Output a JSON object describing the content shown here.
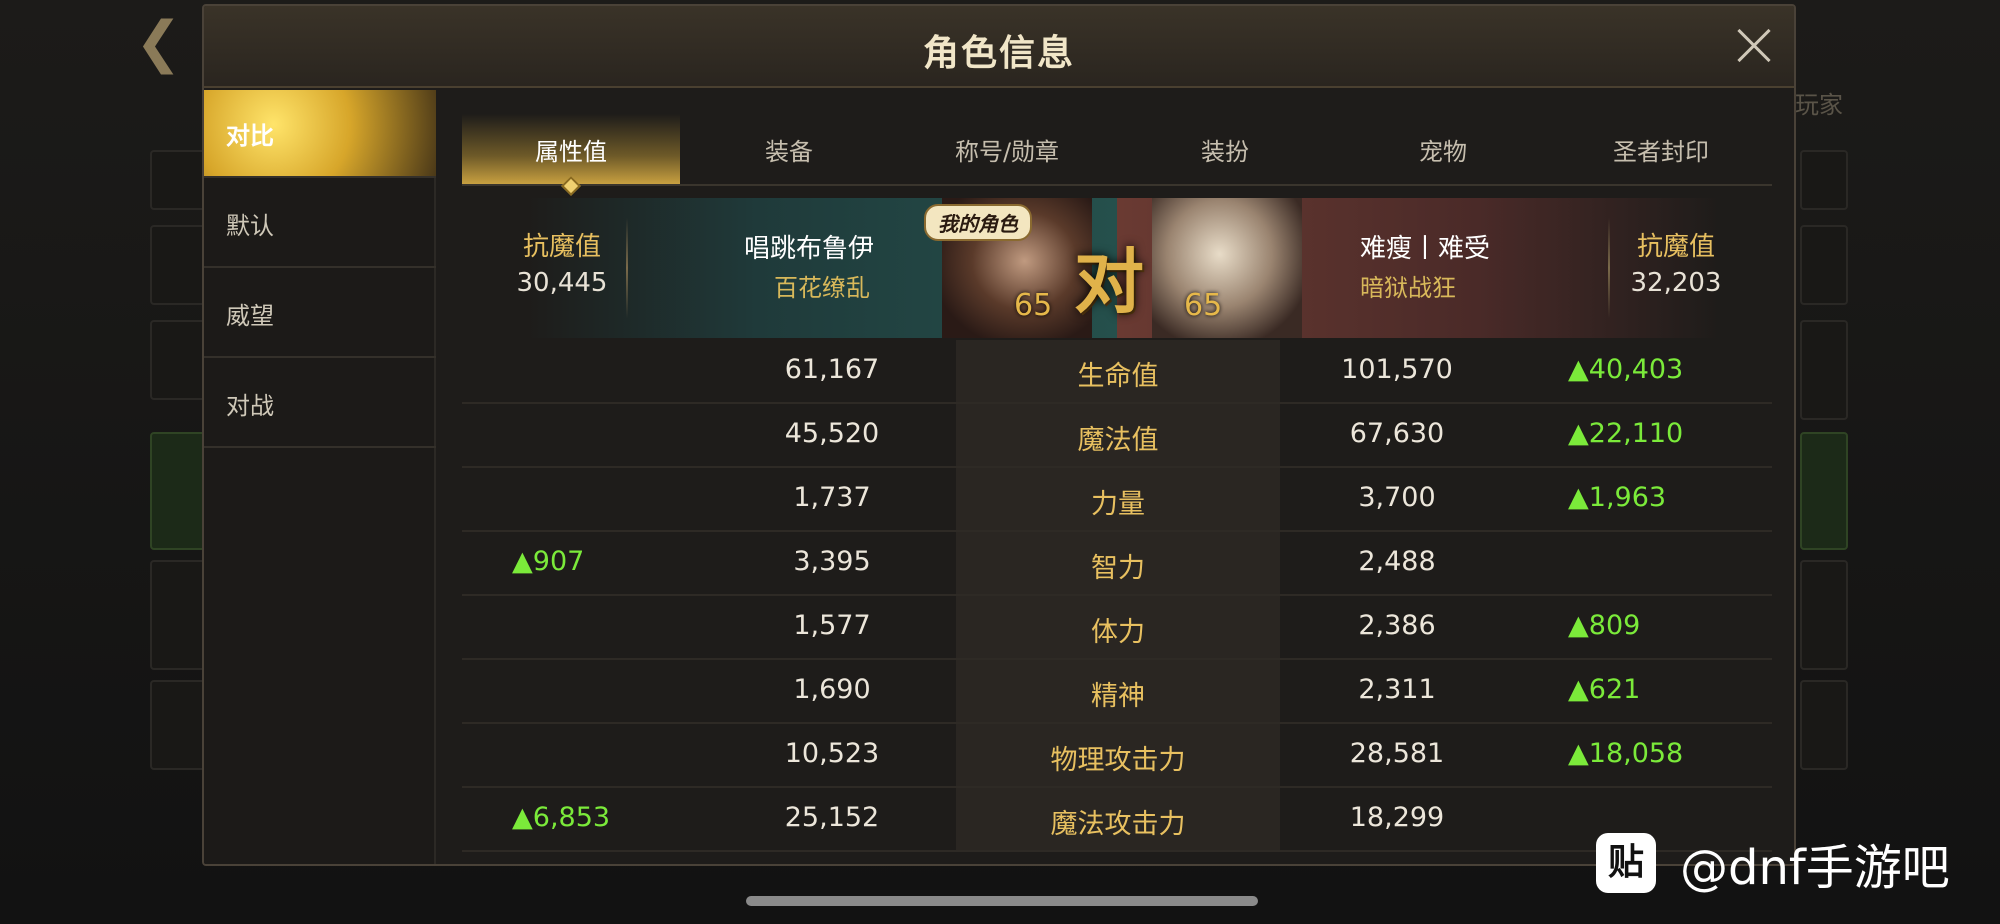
{
  "dialog": {
    "title": "角色信息"
  },
  "sidebar": {
    "items": [
      {
        "label": "对比",
        "active": true
      },
      {
        "label": "默认",
        "active": false
      },
      {
        "label": "威望",
        "active": false
      },
      {
        "label": "对战",
        "active": false
      }
    ]
  },
  "tabs": [
    {
      "label": "属性值",
      "active": true
    },
    {
      "label": "装备",
      "active": false
    },
    {
      "label": "称号/勋章",
      "active": false
    },
    {
      "label": "装扮",
      "active": false
    },
    {
      "label": "宠物",
      "active": false
    },
    {
      "label": "圣者封印",
      "active": false
    }
  ],
  "versus": {
    "vs_char": "对",
    "mine_tag": "我的角色",
    "left": {
      "stat_name": "抗魔值",
      "stat_value": "30,445",
      "player_name": "唱跳布鲁伊",
      "class": "百花缭乱",
      "level": "65"
    },
    "right": {
      "stat_name": "抗魔值",
      "stat_value": "32,203",
      "player_name": "难瘦丨难受",
      "class": "暗狱战狂",
      "level": "65"
    }
  },
  "stats": [
    {
      "left_diff": "",
      "left": "61,167",
      "attr": "生命值",
      "right": "101,570",
      "right_diff": "▲40,403"
    },
    {
      "left_diff": "",
      "left": "45,520",
      "attr": "魔法值",
      "right": "67,630",
      "right_diff": "▲22,110"
    },
    {
      "left_diff": "",
      "left": "1,737",
      "attr": "力量",
      "right": "3,700",
      "right_diff": "▲1,963"
    },
    {
      "left_diff": "▲907",
      "left": "3,395",
      "attr": "智力",
      "right": "2,488",
      "right_diff": ""
    },
    {
      "left_diff": "",
      "left": "1,577",
      "attr": "体力",
      "right": "2,386",
      "right_diff": "▲809"
    },
    {
      "left_diff": "",
      "left": "1,690",
      "attr": "精神",
      "right": "2,311",
      "right_diff": "▲621"
    },
    {
      "left_diff": "",
      "left": "10,523",
      "attr": "物理攻击力",
      "right": "28,581",
      "right_diff": "▲18,058"
    },
    {
      "left_diff": "▲6,853",
      "left": "25,152",
      "attr": "魔法攻击力",
      "right": "18,299",
      "right_diff": ""
    }
  ],
  "watermark": {
    "logo": "贴",
    "text": "@dnf手游吧"
  },
  "background": {
    "back_icon": "back-arrow-icon",
    "corner_label": "玩家"
  }
}
